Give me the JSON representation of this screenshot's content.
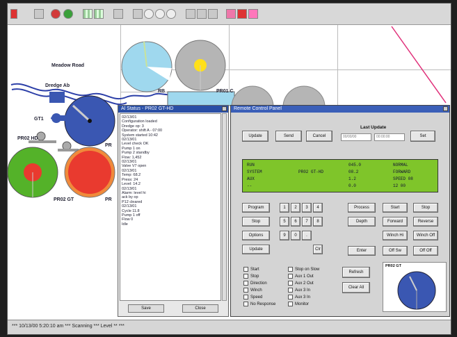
{
  "map": {
    "labels": [
      "Meadow Road",
      "Dredge Ab",
      "RB",
      "GT1",
      "PR",
      "PR",
      "PR01 C",
      "PR02 GT",
      "PR02 HD"
    ]
  },
  "log": {
    "title": "Al Status - PR02 GT-HD",
    "lines": [
      "02/13/01",
      "Configuration loaded",
      "Dredge op: 3",
      "Operator: shift A - 07:00",
      "System started 10:42",
      "02/13/01",
      "Level check OK",
      "Pump 1 on",
      "Pump 2 standby",
      "Flow: 1,452",
      "02/13/01",
      "Valve V7 open",
      "02/13/01",
      "Temp: 68.2",
      "Press: 24",
      "Level: 14.2",
      "02/13/01",
      "Alarm: level hi",
      "ack by op",
      "P12 cleared",
      "02/13/01",
      "Cycle 11.8",
      "Pump 1 off",
      "Flow 0",
      "Idle"
    ],
    "buttons": [
      "Save",
      "Close"
    ]
  },
  "control": {
    "title": "Remote Control Panel",
    "top_buttons": [
      "Update",
      "Send",
      "Cancel"
    ],
    "last_update_label": "Last Update",
    "field1": "00/00/00",
    "field2": "00:00:00",
    "set_button": "Set",
    "lcd": [
      [
        "RUN",
        "",
        "045.0",
        "NORMAL"
      ],
      [
        "SYSTEM",
        "PR02 GT-HD",
        "08.2",
        "FORWARD"
      ],
      [
        "AUX",
        "",
        "1.2",
        "SPEED 08"
      ],
      [
        "--",
        "",
        "0.0",
        "12 00"
      ]
    ],
    "left_buttons": [
      "Program",
      "Stop",
      "Options",
      "Update"
    ],
    "keypad": [
      "1",
      "2",
      "3",
      "4",
      "5",
      "6",
      "7",
      "8",
      "9",
      "0",
      ".",
      "Clr"
    ],
    "right_buttons": [
      "Process",
      "Start",
      "Stop",
      "Depth",
      "Forward",
      "Reverse",
      "Winch Hi",
      "Winch Off",
      "Enter",
      "Off Sw",
      "Off Off"
    ],
    "checks_col1": [
      "Start",
      "Stop",
      "Direction",
      "Winch",
      "Speed",
      "No Response"
    ],
    "checks_col2": [
      "Stop on Slow",
      "Aux 1 Out",
      "Aux 2 Out",
      "Aux 3 In",
      "Aux 3 In",
      "Monitor"
    ],
    "side_buttons": [
      "Refresh",
      "Clear All"
    ],
    "preview_label": "PR02 GT"
  },
  "status": {
    "text": "*** 10/13/00 5:20:10 am *** Scanning *** Level ** ***"
  },
  "colors": {
    "blue_disc": "#3a57b2",
    "green_disc": "#54b229",
    "red_disc": "#e93a2f",
    "orange_ring": "#f08a3b",
    "cyan_disc": "#9fd8ee",
    "gray_disc": "#b5b5b5",
    "yellow_dot": "#ffe01a",
    "lcd_green": "#7fc52a",
    "river_blue": "#2c3fa8"
  }
}
